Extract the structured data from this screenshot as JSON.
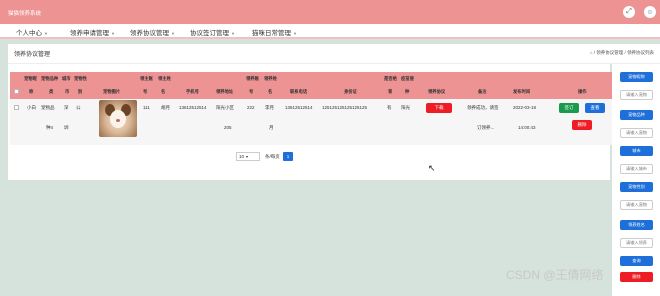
{
  "app": {
    "title": "猫猫领养系统"
  },
  "topbar": {
    "fullscreen_icon": "fullscreen-icon",
    "user_icon": "user-icon"
  },
  "menu": [
    {
      "label": "个人中心"
    },
    {
      "label": "领养申请管理"
    },
    {
      "label": "领养协议管理"
    },
    {
      "label": "协议签订管理"
    },
    {
      "label": "猫咪日常管理"
    }
  ],
  "page": {
    "title": "领养协议管理",
    "breadcrumb": "⌂ / 领养协议管理 / 领养协议列表"
  },
  "table": {
    "header_top": {
      "pet_name": "宠物昵",
      "pet_breed": "宠物品种",
      "city": "城市",
      "pet_gender": "宠物性",
      "adopt_no": "领主账",
      "adopt_name": "领主姓",
      "applicant_no": "领养账",
      "applicant_name": "领养姓",
      "sterilized": "是否绝",
      "vaccine": "疫苗接"
    },
    "header_bottom": {
      "name2": "称",
      "breed2": "类",
      "city2": "市",
      "gender2": "别",
      "image": "宠物图片",
      "adopt_no2": "号",
      "adopt_name2": "名",
      "phone": "手机号",
      "address": "领养地址",
      "applicant_no2": "号",
      "applicant_name2": "名",
      "contact": "联系电话",
      "id_card": "身份证",
      "sterilized2": "育",
      "vaccine2": "种",
      "agreement": "领养协议",
      "remark": "备注",
      "publish_time": "发布时间",
      "actions": "操作"
    },
    "row": {
      "pet_name": "小白",
      "pet_name_2": "",
      "breed": "宠物品",
      "breed_2": "种4",
      "city": "深",
      "city_2": "圳",
      "gender": "公",
      "adopt_no": "111",
      "adopt_name": "胡月",
      "phone": "13612512514",
      "address": "阳光小区",
      "address_2": "205",
      "applicant_no": "222",
      "applicant_name": "李月",
      "applicant_name_2": "月",
      "contact": "13612512514",
      "id_card": "125125125125125125",
      "sterilized": "有",
      "vaccine": "阳光",
      "agreement_btn": "下载",
      "remark": "领养成功，请签",
      "remark_2": "订领养...",
      "publish_date": "2022-03-18",
      "publish_time": "14:00:43",
      "sign_btn": "签订",
      "view_btn": "查看",
      "delete_btn": "删除"
    }
  },
  "pager": {
    "page_size": "10",
    "page_text": "条/每页",
    "current_page": "1"
  },
  "sidebar": {
    "pet_name_btn": "宠物昵称",
    "pet_name_input": "请输入宠物",
    "pet_breed_btn": "宠物品种",
    "pet_breed_input": "请输入宠物",
    "city_btn": "城市",
    "city_input": "请输入城市",
    "gender_btn": "宠物性别",
    "gender_input": "请输入宠物",
    "applicant_btn": "领养姓名",
    "applicant_input": "请输入领养",
    "search_btn": "查询",
    "delete_btn": "删除"
  },
  "watermark": "CSDN @王倩网络",
  "colors": {
    "accent_pink": "#ee9393",
    "blue": "#1e6fd9",
    "red": "#ee1c24",
    "green": "#1a9a4c",
    "background": "#d6e3dc"
  }
}
